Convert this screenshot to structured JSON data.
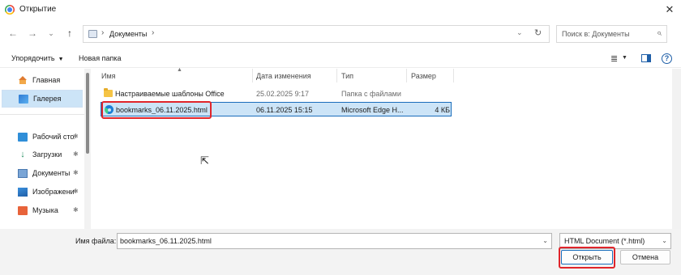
{
  "window": {
    "title": "Открытие",
    "close_glyph": "✕"
  },
  "nav": {
    "back": "←",
    "forward": "→",
    "recent": "⌄",
    "up": "↑"
  },
  "address": {
    "path_sep": "›",
    "location": "Документы",
    "drop": "⌄",
    "refresh": "↻"
  },
  "search": {
    "placeholder": "Поиск в: Документы",
    "icon": "⌕"
  },
  "toolbar": {
    "organize": "Упорядочить",
    "new_folder": "Новая папка",
    "view_glyph": "≣",
    "help_glyph": "?"
  },
  "sidebar": {
    "items": [
      {
        "label": "Главная",
        "icon": "home-icon"
      },
      {
        "label": "Галерея",
        "icon": "gallery-icon",
        "selected": true
      },
      {
        "label": "Рабочий стол",
        "icon": "desktop-icon",
        "pinned": true
      },
      {
        "label": "Загрузки",
        "icon": "downloads-icon",
        "pinned": true
      },
      {
        "label": "Документы",
        "icon": "documents-icon",
        "pinned": true
      },
      {
        "label": "Изображения",
        "icon": "pictures-icon",
        "pinned": true
      },
      {
        "label": "Музыка",
        "icon": "music-icon",
        "pinned": true
      }
    ],
    "pin_glyph": "📌"
  },
  "columns": {
    "name": "Имя",
    "date": "Дата изменения",
    "type": "Тип",
    "size": "Размер"
  },
  "files": [
    {
      "name": "Настраиваемые шаблоны Office",
      "date": "25.02.2025 9:17",
      "type": "Папка с файлами",
      "size": "",
      "icon": "folder-icon"
    },
    {
      "name": "bookmarks_06.11.2025.html",
      "date": "06.11.2025 15:15",
      "type": "Microsoft Edge H...",
      "size": "4 КБ",
      "icon": "edge-icon",
      "selected": true
    }
  ],
  "footer": {
    "filename_label": "Имя файла:",
    "filename_value": "bookmarks_06.11.2025.html",
    "filter": "HTML Document (*.html)",
    "open_button": "Открыть",
    "cancel_button": "Отмена"
  },
  "colors": {
    "highlight_red": "#e0252b",
    "selection_blue": "#cce4f7",
    "accent_blue": "#1a6dbb"
  }
}
